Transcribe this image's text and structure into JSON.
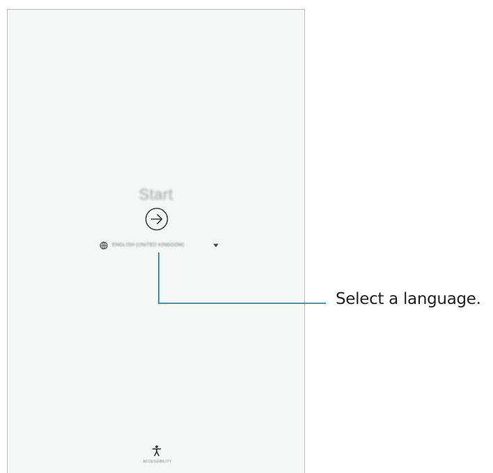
{
  "screen": {
    "title": "Start",
    "language": {
      "label": "ENGLISH (UNITED KINGDOM)",
      "globe_icon": "globe-icon",
      "dropdown_icon": "dropdown-arrow-icon"
    },
    "start_icon": "arrow-right-circle-icon",
    "accessibility": {
      "icon": "accessibility-icon",
      "label": "ACCESSIBILITY"
    }
  },
  "callout": {
    "text": "Select a language.",
    "line_color": "#1a8bc6"
  }
}
